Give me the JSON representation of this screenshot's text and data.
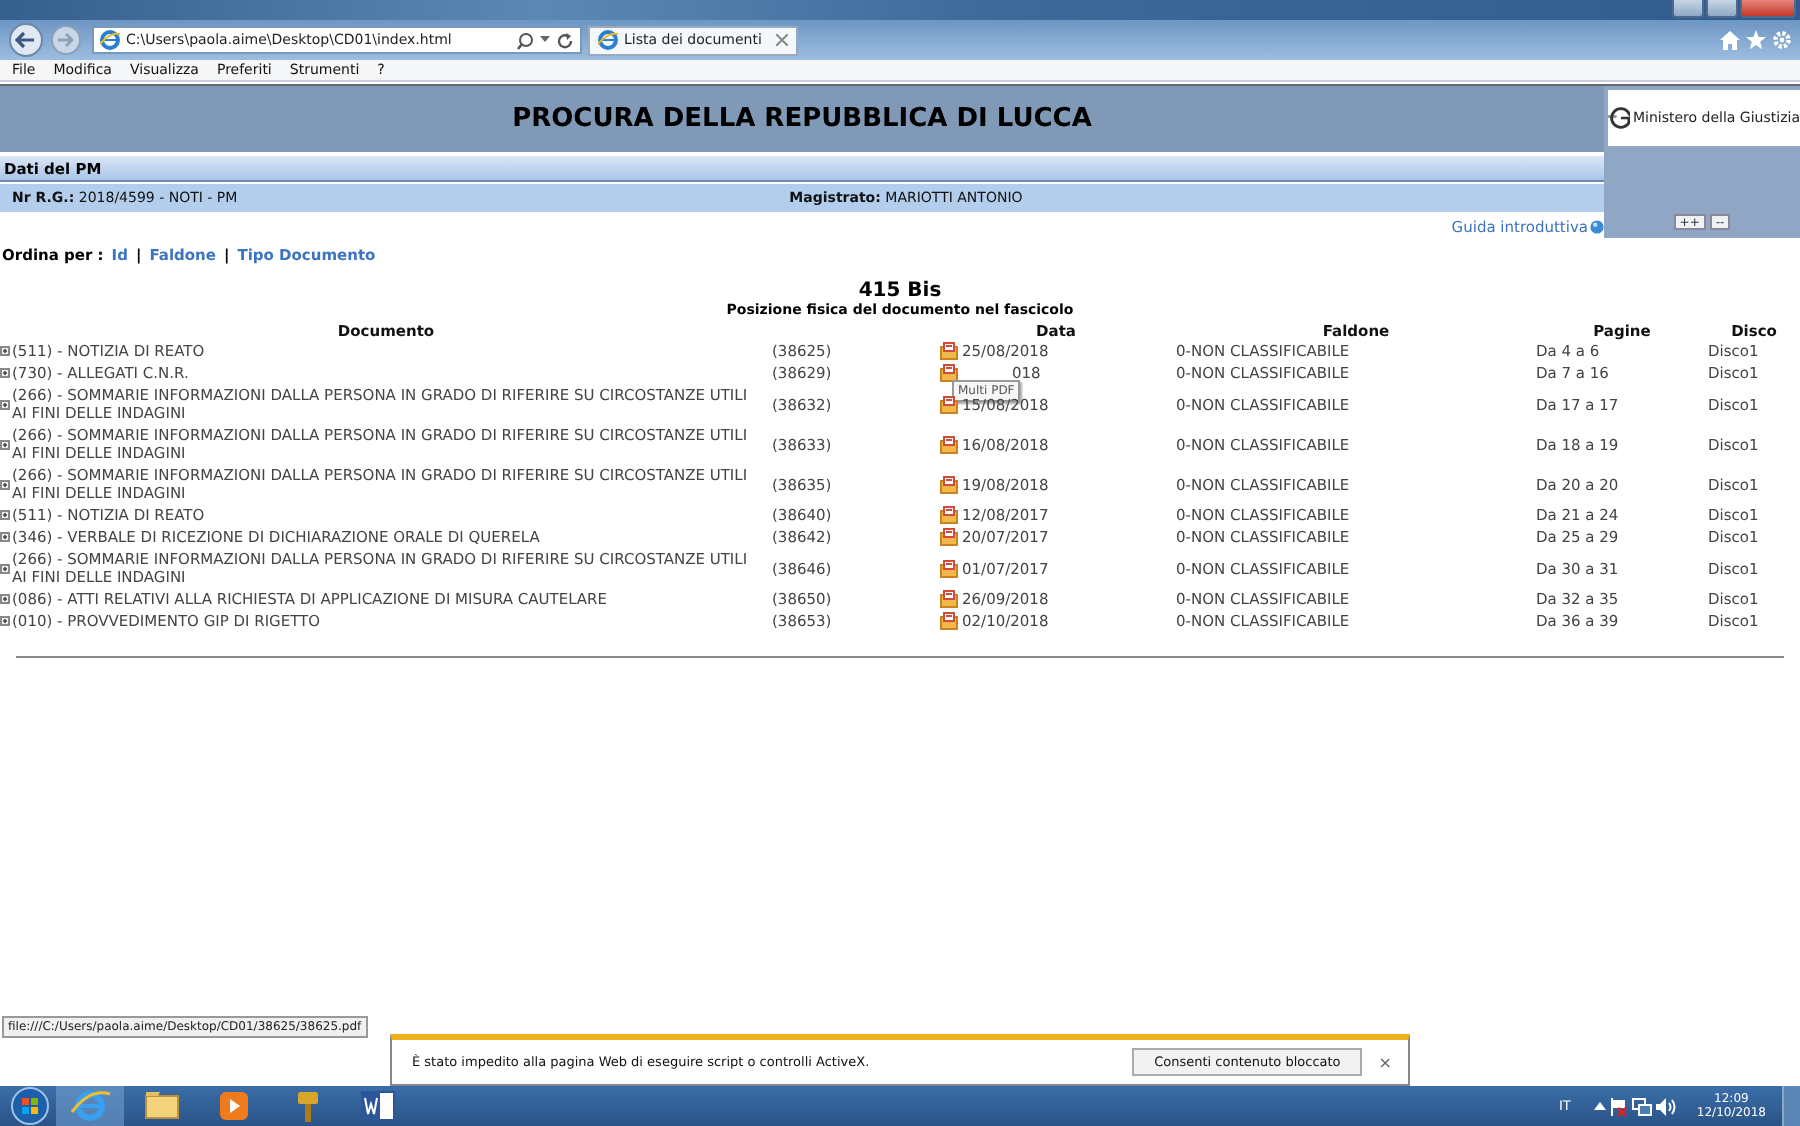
{
  "browser": {
    "address": "C:\\Users\\paola.aime\\Desktop\\CD01\\index.html",
    "tab_title": "Lista dei documenti",
    "menu": [
      "File",
      "Modifica",
      "Visualizza",
      "Preferiti",
      "Strumenti",
      "?"
    ]
  },
  "header": {
    "title": "PROCURA DELLA REPUBBLICA DI LUCCA",
    "logo_text": "Ministero della Giustizia",
    "panel_buttons": [
      "++",
      "--"
    ]
  },
  "pm": {
    "section": "Dati del PM",
    "nr_label": "Nr R.G.:",
    "nr_value": "2018/4599 - NOTI - PM",
    "magistrato_label": "Magistrato:",
    "magistrato_value": "MARIOTTI ANTONIO"
  },
  "guide_link": "Guida introduttiva",
  "sort": {
    "label": "Ordina per :",
    "separator": "|",
    "links": [
      "Id",
      "Faldone",
      "Tipo Documento"
    ]
  },
  "title": "415 Bis",
  "subtitle": "Posizione fisica del documento nel fascicolo",
  "columns": {
    "document": "Documento",
    "date": "Data",
    "folder": "Faldone",
    "pages": "Pagine",
    "disk": "Disco"
  },
  "rows": [
    {
      "document": "(511) - NOTIZIA DI REATO",
      "id": "(38625)",
      "date": "25/08/2018",
      "folder": "0-NON CLASSIFICABILE",
      "pages": "Da 4 a 6",
      "disk": "Disco1"
    },
    {
      "document": "(730) - ALLEGATI C.N.R.",
      "id": "(38629)",
      "date": "018",
      "tooltip": "Multi PDF",
      "folder": "0-NON CLASSIFICABILE",
      "pages": "Da 7 a 16",
      "disk": "Disco1"
    },
    {
      "document": "(266) - SOMMARIE INFORMAZIONI DALLA PERSONA IN GRADO DI RIFERIRE SU CIRCOSTANZE UTILI AI FINI DELLE INDAGINI",
      "id": "(38632)",
      "date": "15/08/2018",
      "folder": "0-NON CLASSIFICABILE",
      "pages": "Da 17 a 17",
      "disk": "Disco1"
    },
    {
      "document": "(266) - SOMMARIE INFORMAZIONI DALLA PERSONA IN GRADO DI RIFERIRE SU CIRCOSTANZE UTILI AI FINI DELLE INDAGINI",
      "id": "(38633)",
      "date": "16/08/2018",
      "folder": "0-NON CLASSIFICABILE",
      "pages": "Da 18 a 19",
      "disk": "Disco1"
    },
    {
      "document": "(266) - SOMMARIE INFORMAZIONI DALLA PERSONA IN GRADO DI RIFERIRE SU CIRCOSTANZE UTILI AI FINI DELLE INDAGINI",
      "id": "(38635)",
      "date": "19/08/2018",
      "folder": "0-NON CLASSIFICABILE",
      "pages": "Da 20 a 20",
      "disk": "Disco1"
    },
    {
      "document": "(511) - NOTIZIA DI REATO",
      "id": "(38640)",
      "date": "12/08/2017",
      "folder": "0-NON CLASSIFICABILE",
      "pages": "Da 21 a 24",
      "disk": "Disco1"
    },
    {
      "document": "(346) - VERBALE DI RICEZIONE DI DICHIARAZIONE ORALE DI QUERELA",
      "id": "(38642)",
      "date": "20/07/2017",
      "folder": "0-NON CLASSIFICABILE",
      "pages": "Da 25 a 29",
      "disk": "Disco1"
    },
    {
      "document": "(266) - SOMMARIE INFORMAZIONI DALLA PERSONA IN GRADO DI RIFERIRE SU CIRCOSTANZE UTILI AI FINI DELLE INDAGINI",
      "id": "(38646)",
      "date": "01/07/2017",
      "folder": "0-NON CLASSIFICABILE",
      "pages": "Da 30 a 31",
      "disk": "Disco1"
    },
    {
      "document": "(086) - ATTI RELATIVI ALLA RICHIESTA DI APPLICAZIONE DI MISURA CAUTELARE",
      "id": "(38650)",
      "date": "26/09/2018",
      "folder": "0-NON CLASSIFICABILE",
      "pages": "Da 32 a 35",
      "disk": "Disco1"
    },
    {
      "document": "(010) - PROVVEDIMENTO GIP DI RIGETTO",
      "id": "(38653)",
      "date": "02/10/2018",
      "folder": "0-NON CLASSIFICABILE",
      "pages": "Da 36 a 39",
      "disk": "Disco1"
    }
  ],
  "status_url": "file:///C:/Users/paola.aime/Desktop/CD01/38625/38625.pdf",
  "notification": {
    "text": "È stato impedito alla pagina Web di eseguire script o controlli ActiveX.",
    "button": "Consenti contenuto bloccato",
    "close": "×"
  },
  "taskbar": {
    "language": "IT",
    "time": "12:09",
    "date": "12/10/2018"
  }
}
